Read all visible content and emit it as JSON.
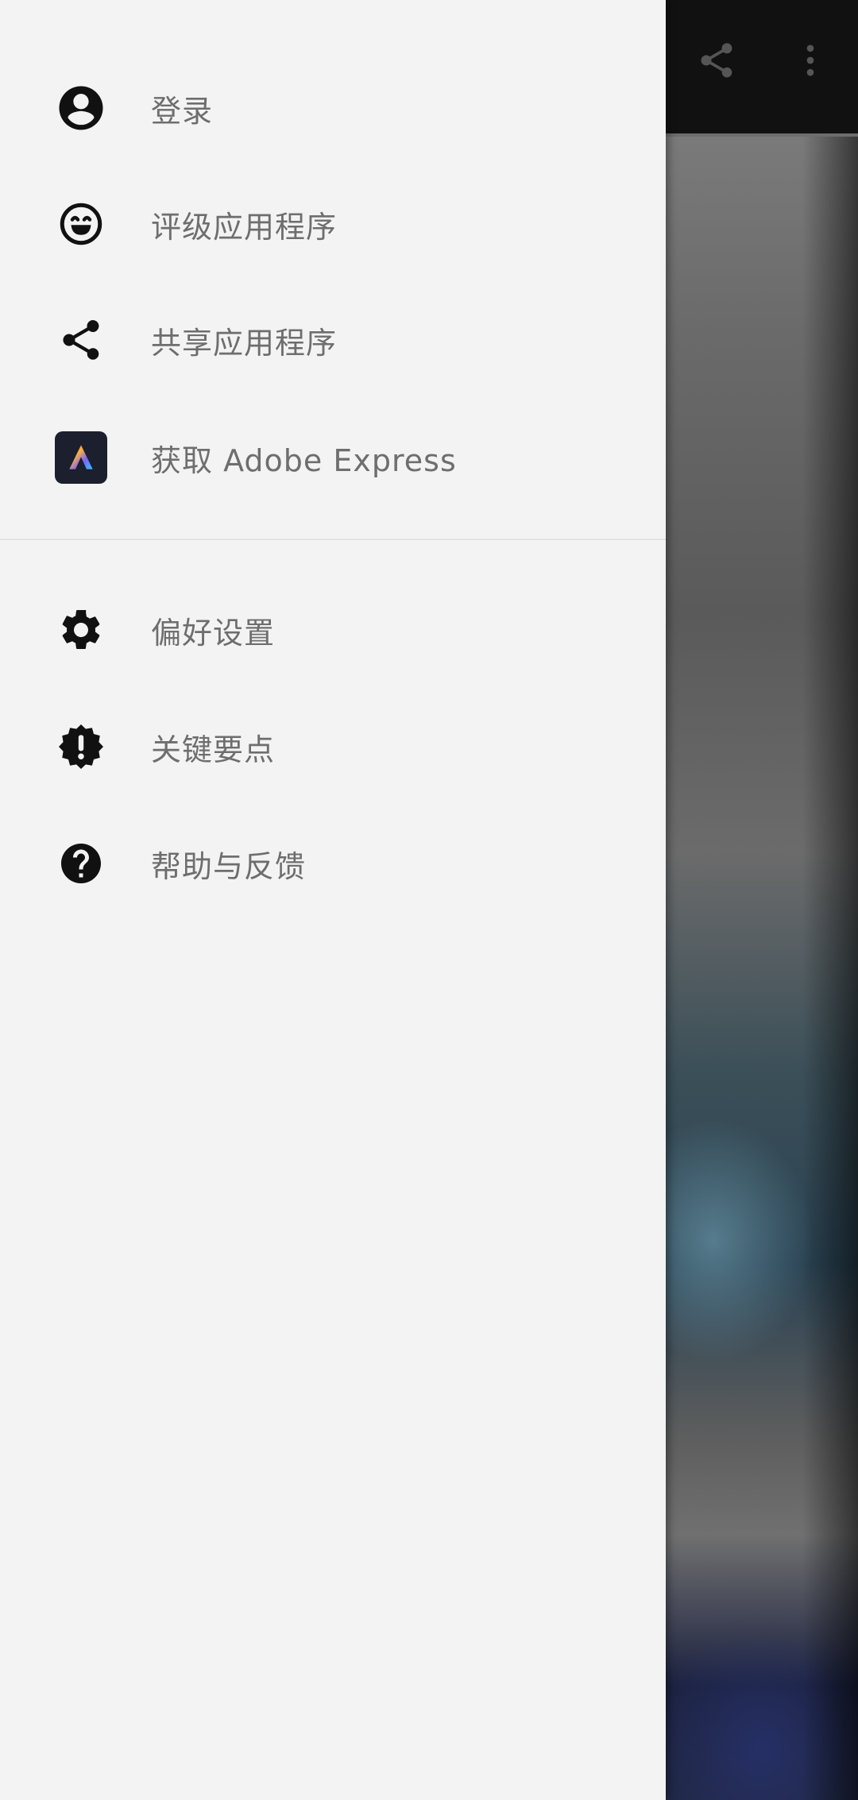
{
  "toolbar": {
    "icons": [
      "share-icon",
      "more-vert-icon"
    ]
  },
  "drawer": {
    "items": [
      {
        "label": "登录",
        "icon": "account-circle-icon"
      },
      {
        "label": "评级应用程序",
        "icon": "smile-face-icon"
      },
      {
        "label": "共享应用程序",
        "icon": "share-icon"
      },
      {
        "label": "获取 Adobe Express",
        "icon": "adobe-express-icon"
      },
      {
        "label": "偏好设置",
        "icon": "gear-icon"
      },
      {
        "label": "关键要点",
        "icon": "alert-badge-icon"
      },
      {
        "label": "帮助与反馈",
        "icon": "help-circle-icon"
      }
    ]
  },
  "colors": {
    "drawer_bg": "#f3f3f3",
    "label_text": "#6e6e6e",
    "icon": "#111111",
    "toolbar_bg": "#111111"
  }
}
